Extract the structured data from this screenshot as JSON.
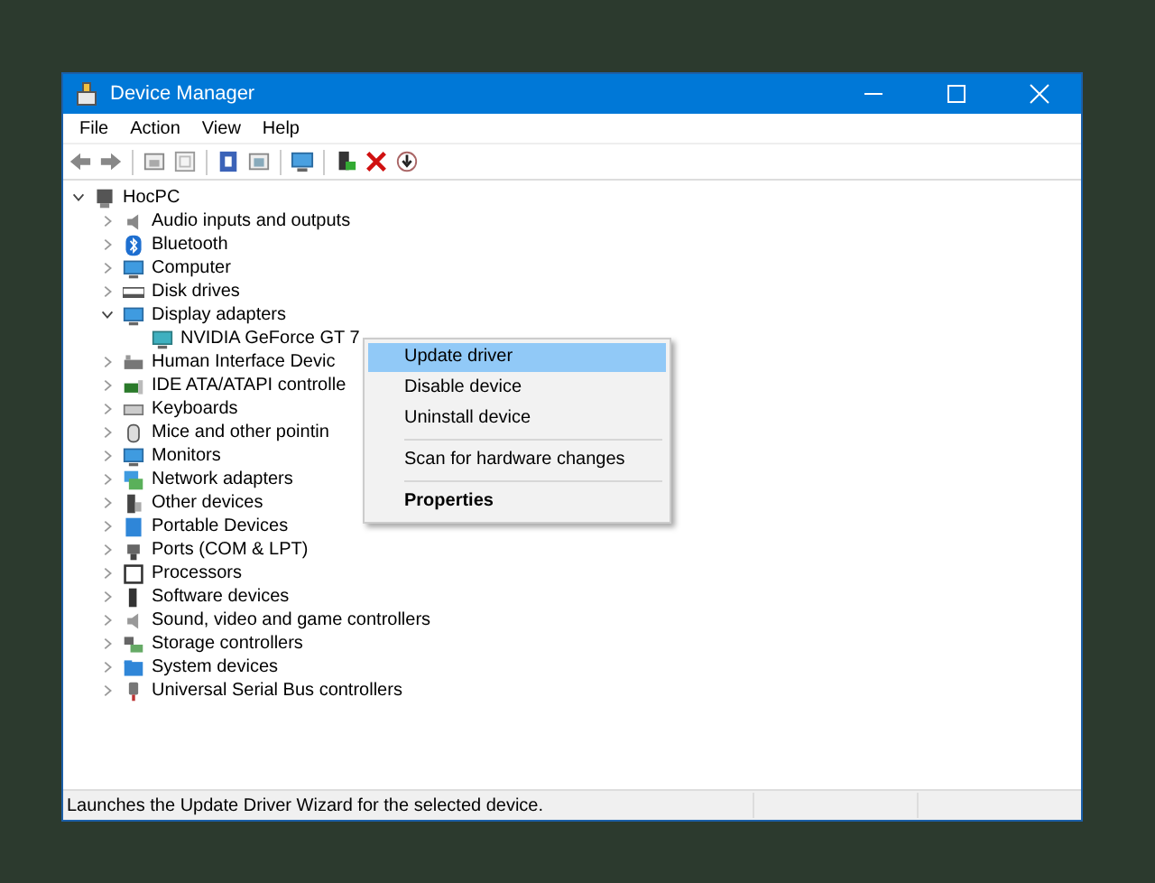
{
  "window": {
    "title": "Device Manager"
  },
  "menu_bar": [
    "File",
    "Action",
    "View",
    "Help"
  ],
  "tree": [
    {
      "label": "HocPC",
      "expanded": true,
      "children": [
        {
          "label": "Audio inputs and outputs",
          "expanded": false
        },
        {
          "label": "Bluetooth",
          "expanded": false
        },
        {
          "label": "Computer",
          "expanded": false
        },
        {
          "label": "Disk drives",
          "expanded": false
        },
        {
          "label": "Display adapters",
          "expanded": true,
          "children": [
            {
              "label": "NVIDIA GeForce GT 7"
            }
          ]
        },
        {
          "label": "Human Interface Devic",
          "expanded": false
        },
        {
          "label": "IDE ATA/ATAPI controlle",
          "expanded": false
        },
        {
          "label": "Keyboards",
          "expanded": false
        },
        {
          "label": "Mice and other pointin",
          "expanded": false
        },
        {
          "label": "Monitors",
          "expanded": false
        },
        {
          "label": "Network adapters",
          "expanded": false
        },
        {
          "label": "Other devices",
          "expanded": false
        },
        {
          "label": "Portable Devices",
          "expanded": false
        },
        {
          "label": "Ports (COM & LPT)",
          "expanded": false
        },
        {
          "label": "Processors",
          "expanded": false
        },
        {
          "label": "Software devices",
          "expanded": false
        },
        {
          "label": "Sound, video and game controllers",
          "expanded": false
        },
        {
          "label": "Storage controllers",
          "expanded": false
        },
        {
          "label": "System devices",
          "expanded": false
        },
        {
          "label": "Universal Serial Bus controllers",
          "expanded": false
        }
      ]
    }
  ],
  "context_menu": [
    {
      "kind": "item",
      "label": "Update driver",
      "selected": true
    },
    {
      "kind": "item",
      "label": "Disable device",
      "selected": false
    },
    {
      "kind": "item",
      "label": "Uninstall device",
      "selected": false
    },
    {
      "kind": "separator"
    },
    {
      "kind": "item",
      "label": "Scan for hardware changes",
      "selected": false
    },
    {
      "kind": "separator"
    },
    {
      "kind": "default",
      "label": "Properties",
      "selected": false
    }
  ],
  "status_bar": {
    "text": "Launches the Update Driver Wizard for the selected device."
  }
}
